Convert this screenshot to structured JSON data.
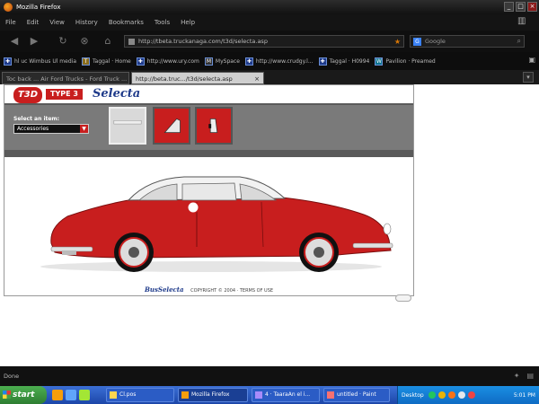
{
  "window": {
    "title": "Mozilla Firefox",
    "controls": [
      "_",
      "□",
      "×"
    ]
  },
  "menu": [
    "File",
    "Edit",
    "View",
    "History",
    "Bookmarks",
    "Tools",
    "Help"
  ],
  "nav": {
    "url": "http://tbeta.truckanaga.com/t3d/selecta.asp",
    "search_placeholder": "Google"
  },
  "bookmarks": [
    {
      "label": "hl uc Wimbus Ul media"
    },
    {
      "label": "Taggal · Home"
    },
    {
      "label": "http://www.ury.com"
    },
    {
      "label": "MySpace"
    },
    {
      "label": "http://www.crudgy.l..."
    },
    {
      "label": "Taggal · H0994"
    },
    {
      "label": "Pavilion · Preamed"
    }
  ],
  "tabs": [
    {
      "label": "Toc back ... Air Ford Trucks - Ford Truck ..."
    },
    {
      "label": "http://beta.truc.../t3d/selecta.asp"
    }
  ],
  "site": {
    "logo_t3d": "T3D",
    "logo_type": "TYPE 3",
    "logo_selecta": "Selecta",
    "select_label": "Select an item:",
    "select_value": "Accessories",
    "footer_brand": "BusSelecta",
    "footer_text": "COPYRIGHT © 2004 · TERMS OF USE"
  },
  "status": {
    "text": "Done"
  },
  "taskbar": {
    "start": "start",
    "buttons": [
      {
        "label": "Cl.pos"
      },
      {
        "label": "Mozilla Firefox"
      },
      {
        "label": "4 · TaaraAn el i..."
      },
      {
        "label": "untitled · Paint"
      }
    ],
    "tray_label": "Desktop",
    "clock": "5:01 PM"
  },
  "colors": {
    "car_red": "#c81e1e",
    "site_gray": "#7a7a7a",
    "brand_blue": "#1e3a8a"
  }
}
